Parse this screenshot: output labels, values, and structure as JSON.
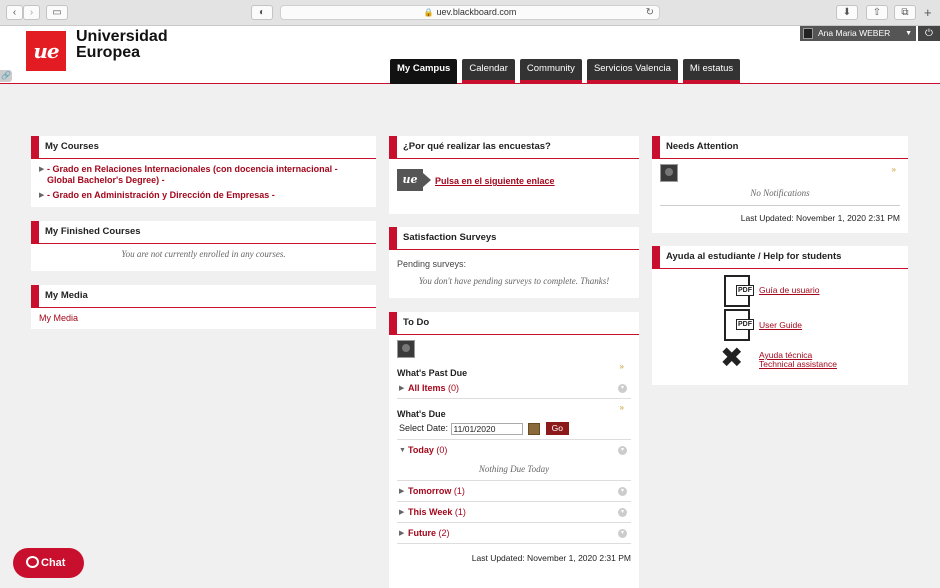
{
  "browser": {
    "url": "uev.blackboard.com",
    "back_glyph": "‹",
    "forward_glyph": "›",
    "new_tab_glyph": "+"
  },
  "header": {
    "logo_mark": "ue",
    "logo_line1": "Universidad",
    "logo_line2": "Europea",
    "user_name": "Ana Maria WEBER",
    "tabs": [
      {
        "label": "My Campus",
        "active": true
      },
      {
        "label": "Calendar"
      },
      {
        "label": "Community"
      },
      {
        "label": "Servicios Valencia"
      },
      {
        "label": "Mi estatus"
      }
    ]
  },
  "my_courses": {
    "title": "My Courses",
    "items": [
      "- Grado en Relaciones Internacionales (con docencia internacional - Global Bachelor's Degree) -",
      "- Grado en Administración y Dirección de Empresas -"
    ]
  },
  "finished_courses": {
    "title": "My Finished Courses",
    "note": "You are not currently enrolled in any courses."
  },
  "my_media": {
    "title": "My Media",
    "link": "My Media"
  },
  "encuestas": {
    "title": "¿Por qué realizar las encuestas?",
    "link": "Pulsa en el siguiente enlace"
  },
  "surveys": {
    "title": "Satisfaction Surveys",
    "pending_label": "Pending surveys:",
    "note": "You don't have pending surveys to complete. Thanks!"
  },
  "todo": {
    "title": "To Do",
    "past_due_label": "What's Past Due",
    "all_items_label": "All Items",
    "all_items_count": "(0)",
    "due_label": "What's Due",
    "select_date_label": "Select Date:",
    "date_value": "11/01/2020",
    "go_label": "Go",
    "today_label": "Today",
    "today_count": "(0)",
    "nothing_due": "Nothing Due Today",
    "tomorrow_label": "Tomorrow",
    "tomorrow_count": "(1)",
    "week_label": "This Week",
    "week_count": "(1)",
    "future_label": "Future",
    "future_count": "(2)",
    "last_updated": "Last Updated: November 1, 2020 2:31 PM"
  },
  "needs_attention": {
    "title": "Needs Attention",
    "note": "No Notifications",
    "last_updated": "Last Updated: November 1, 2020 2:31 PM"
  },
  "help": {
    "title": "Ayuda al estudiante / Help for students",
    "pdf_label": "PDF",
    "link1": "Guía de usuario",
    "link2": "User Guide",
    "link3a": "Ayuda técnica",
    "link3b": "Technical assistance"
  },
  "chat": {
    "label": "Chat"
  },
  "colors": {
    "brand_red": "#c8102e",
    "link_red": "#a3081d"
  }
}
